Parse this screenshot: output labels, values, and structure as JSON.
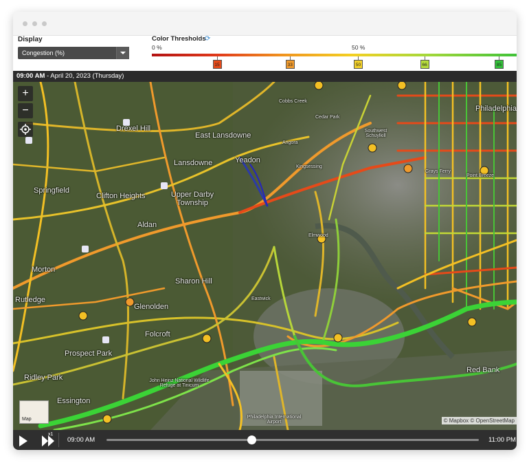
{
  "display": {
    "label": "Display",
    "selected": "Congestion (%)"
  },
  "thresholds": {
    "title": "Color Thresholds",
    "pct_start": "0 %",
    "pct_mid": "50 %",
    "markers": [
      {
        "value": "15",
        "color": "#e64a19",
        "pos": 0.178
      },
      {
        "value": "33",
        "color": "#f09a2c",
        "pos": 0.378
      },
      {
        "value": "50",
        "color": "#f4d22a",
        "pos": 0.565
      },
      {
        "value": "66",
        "color": "#b7dd3c",
        "pos": 0.747
      },
      {
        "value": "85",
        "color": "#33c23a",
        "pos": 0.951
      }
    ]
  },
  "timebar": {
    "time": "09:00 AM",
    "date": " - April 20, 2023 (Thursday)"
  },
  "map": {
    "zoom_in": "+",
    "zoom_out": "−",
    "thumb_label": "Map",
    "attribution": "© Mapbox © OpenStreetMap",
    "labels": [
      "Drexel Hill",
      "East Lansdowne",
      "Lansdowne",
      "Yeadon",
      "Springfield",
      "Clifton Heights",
      "Upper Darby Township",
      "Aldan",
      "Morton",
      "Rutledge",
      "Sharon Hill",
      "Glenolden",
      "Folcroft",
      "Prospect Park",
      "Ridley Park",
      "Essington",
      "John Heinz National Wildlife Refuge at Tinicum",
      "Philadelphia International Airport",
      "Kingsessing",
      "Elmwood",
      "Eastwick",
      "Southwest Schuylkill",
      "Cedar Park",
      "Philadelphia",
      "Point Breeze",
      "Grays Ferry",
      "Red Bank",
      "Cobbs Creek",
      "Angora"
    ]
  },
  "player": {
    "start_time": "09:00 AM",
    "end_time": "11:00 PM",
    "speed": "x1",
    "progress": 0.39
  }
}
